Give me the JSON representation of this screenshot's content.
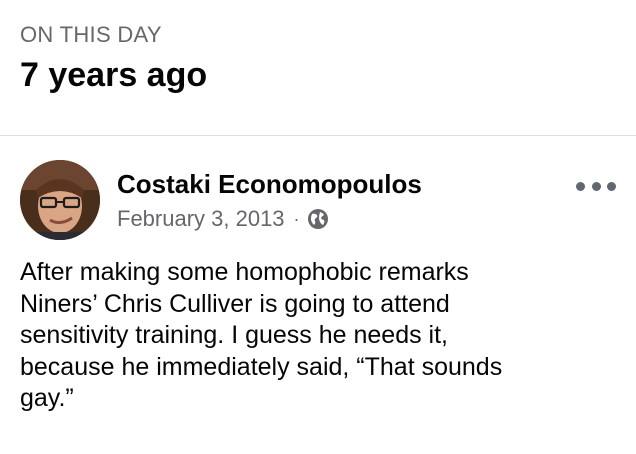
{
  "memory": {
    "eyebrow": "ON THIS DAY",
    "headline": "7 years ago"
  },
  "post": {
    "author": "Costaki Economopoulos",
    "date": "February 3, 2013",
    "separator": "·",
    "audience_icon": "globe-icon",
    "more_icon": "more-options-icon",
    "text": "After making some homophobic remarks\nNiners’ Chris Culliver is going to attend\nsensitivity training.  I guess he needs it,\nbecause he immediately said, “That sounds\ngay.”"
  },
  "colors": {
    "secondary_text": "#65676b",
    "primary_text": "#050505",
    "divider": "#dadde1"
  }
}
